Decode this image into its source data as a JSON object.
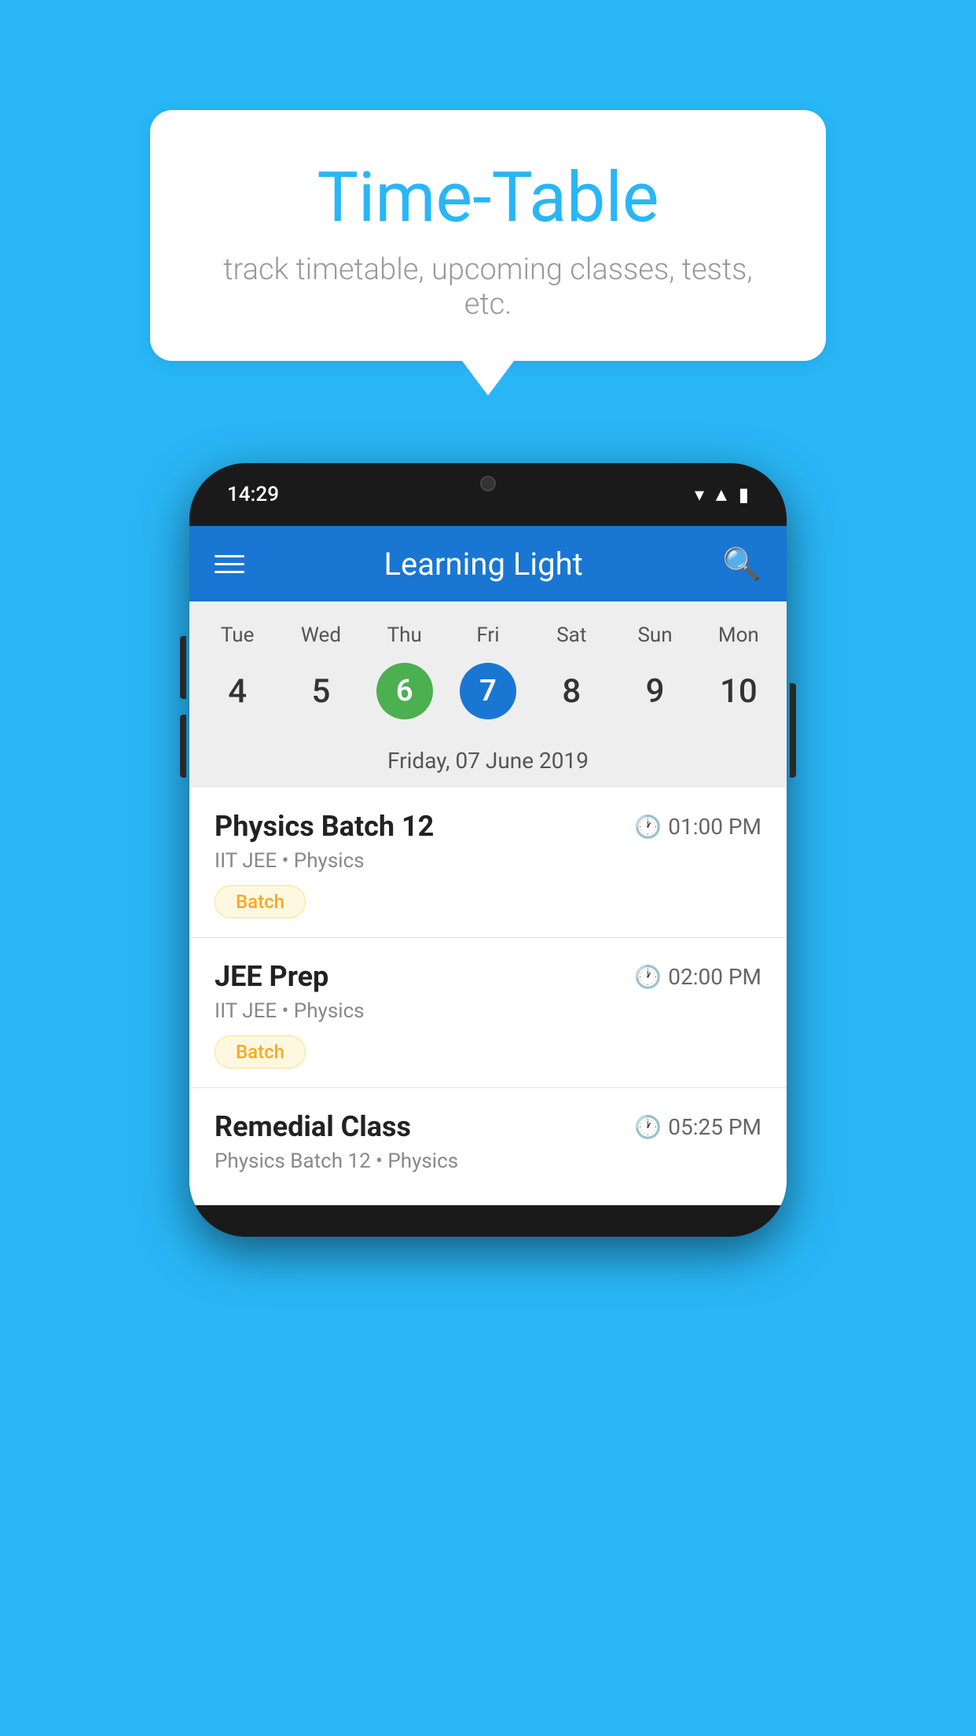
{
  "background_color": "#29B6F6",
  "bubble": {
    "title": "Time-Table",
    "subtitle": "track timetable, upcoming classes, tests, etc."
  },
  "phone": {
    "status_bar": {
      "time": "14:29"
    },
    "app_bar": {
      "title": "Learning Light",
      "menu_icon": "menu",
      "search_icon": "search"
    },
    "calendar": {
      "day_headers": [
        "Tue",
        "Wed",
        "Thu",
        "Fri",
        "Sat",
        "Sun",
        "Mon"
      ],
      "day_numbers": [
        "4",
        "5",
        "6",
        "7",
        "8",
        "9",
        "10"
      ],
      "today_index": 2,
      "selected_index": 3,
      "selected_date_label": "Friday, 07 June 2019"
    },
    "schedule_items": [
      {
        "title": "Physics Batch 12",
        "time": "01:00 PM",
        "subtitle": "IIT JEE • Physics",
        "badge": "Batch"
      },
      {
        "title": "JEE Prep",
        "time": "02:00 PM",
        "subtitle": "IIT JEE • Physics",
        "badge": "Batch"
      },
      {
        "title": "Remedial Class",
        "time": "05:25 PM",
        "subtitle": "Physics Batch 12 • Physics",
        "badge": null
      }
    ]
  }
}
